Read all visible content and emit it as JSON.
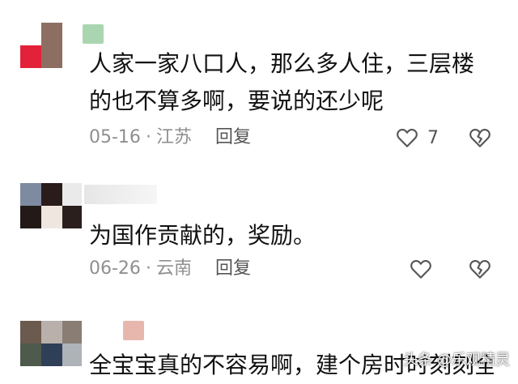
{
  "comments": [
    {
      "text": "人家一家八口人，那么多人住，三层楼的也不算多啊，要说的还少呢",
      "date": "05-16",
      "location": "江苏",
      "reply_label": "回复",
      "like_count": "7"
    },
    {
      "text": "为国作贡献的，奖励。",
      "date": "06-26",
      "location": "云南",
      "reply_label": "回复",
      "like_count": ""
    },
    {
      "text": "全宝宝真的不容易啊，建个房时时刻刻全",
      "date": "",
      "location": "",
      "reply_label": "",
      "like_count": ""
    }
  ],
  "separator": "·",
  "watermark": "头条 @乐观精灵",
  "icons": {
    "like": "heart-outline-icon",
    "dislike": "broken-heart-icon"
  }
}
